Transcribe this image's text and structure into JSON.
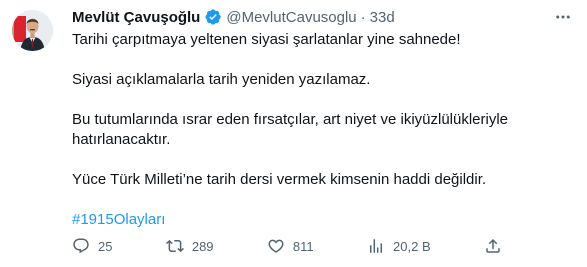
{
  "author": {
    "name": "Mevlüt Çavuşoğlu",
    "handle": "@MevlutCavusoglu",
    "separator": "·",
    "time": "33d"
  },
  "tweet": {
    "paragraphs": [
      "Tarihi çarpıtmaya yeltenen siyasi şarlatanlar yine sahnede!",
      "Siyasi açıklamalarla tarih yeniden yazılamaz.",
      "Bu tutumlarında ısrar eden fırsatçılar, art niyet ve ikiyüzlülükleriyle hatırlanacaktır.",
      "Yüce Türk Milleti’ne tarih dersi vermek kimsenin haddi değildir."
    ],
    "hashtag": "#1915Olayları"
  },
  "actions": {
    "replies": "25",
    "retweets": "289",
    "likes": "811",
    "views": "20,2 B"
  },
  "colors": {
    "accent": "#1d9bf0",
    "secondary_text": "#536471",
    "primary_text": "#0f1419"
  },
  "icons": {
    "verified": "verified-badge-icon",
    "more": "more-dots-icon",
    "reply": "reply-icon",
    "retweet": "retweet-icon",
    "like": "heart-icon",
    "views": "views-bar-chart-icon",
    "share": "share-icon"
  }
}
